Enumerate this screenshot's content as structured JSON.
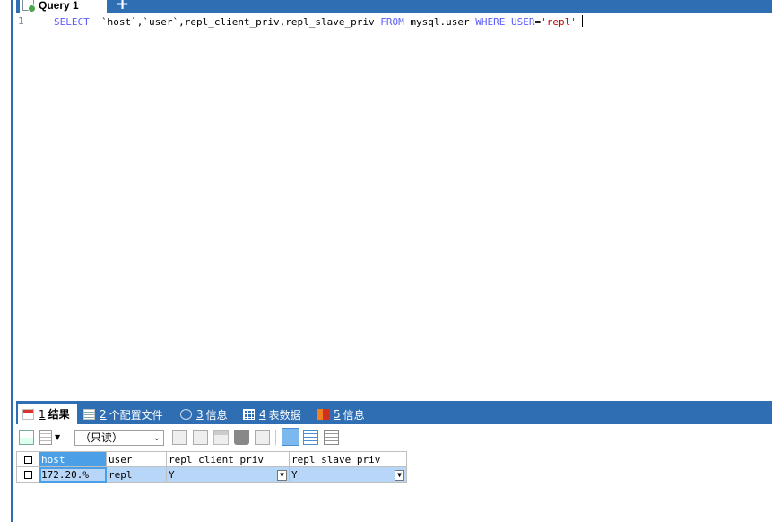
{
  "query_tab": {
    "title": "Query 1",
    "add_label": "+"
  },
  "editor": {
    "line_number": "1",
    "sql": {
      "select": "SELECT",
      "columns": "  `host`,`user`,repl_client_priv,repl_slave_priv ",
      "from": "FROM",
      "table": " mysql.user ",
      "where": "WHERE",
      "field": " USER",
      "eq": "=",
      "value": "'repl'"
    }
  },
  "result_tabs": [
    {
      "num": "1",
      "label": "结果"
    },
    {
      "num": "2",
      "label": "个配置文件"
    },
    {
      "num": "3",
      "label": "信息"
    },
    {
      "num": "4",
      "label": "表数据"
    },
    {
      "num": "5",
      "label": "信息"
    }
  ],
  "toolbar": {
    "mode_select": "（只读）"
  },
  "grid": {
    "columns": [
      "host",
      "user",
      "repl_client_priv",
      "repl_slave_priv"
    ],
    "rows": [
      {
        "host": "172.20.%",
        "user": "repl",
        "repl_client_priv": "Y",
        "repl_slave_priv": "Y"
      }
    ]
  },
  "colors": {
    "accent": "#2f6eb3",
    "selection": "#4a9fe6",
    "row_highlight": "#b8d6f7",
    "keyword": "#5a5cff",
    "string": "#c00000"
  }
}
